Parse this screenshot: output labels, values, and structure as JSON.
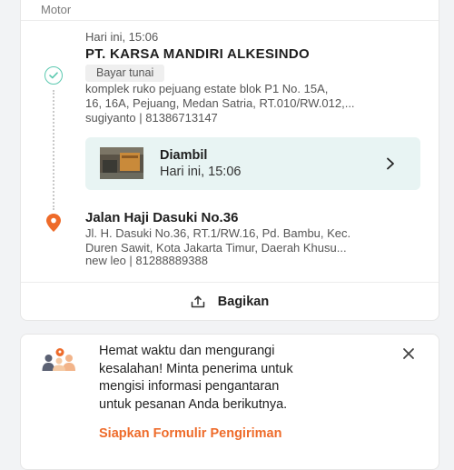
{
  "order": {
    "vehicle": "Motor",
    "sender": {
      "time": "Hari ini, 15:06",
      "name": "PT. KARSA MANDIRI ALKESINDO",
      "payment_badge": "Bayar tunai",
      "address_line1": "komplek ruko pejuang estate blok P1 No. 15A,",
      "address_line2": "16, 16A, Pejuang, Medan Satria, RT.010/RW.012,...",
      "contact": "sugiyanto | 81386713147"
    },
    "status": {
      "title": "Diambil",
      "time": "Hari ini, 15:06",
      "chevron_icon": "chevron-right-icon"
    },
    "recipient": {
      "street": "Jalan Haji Dasuki No.36",
      "address_line1": "Jl. H. Dasuki No.36, RT.1/RW.16, Pd. Bambu, Kec.",
      "address_line2": "Duren Sawit, Kota Jakarta Timur, Daerah Khusu...",
      "contact": "new leo | 81288889388"
    },
    "share": {
      "label": "Bagikan",
      "icon": "share-icon"
    }
  },
  "promo": {
    "text_line1": "Hemat waktu dan mengurangi",
    "text_line2": "kesalahan! Minta penerima untuk",
    "text_line3": "mengisi informasi pengantaran",
    "text_line4": "untuk pesanan Anda berikutnya.",
    "link": "Siapkan Formulir Pengiriman",
    "icon": "recipients-icon",
    "close_icon": "close-icon"
  },
  "colors": {
    "accent_orange": "#ee6b2a",
    "status_teal": "#5cc9b0",
    "status_bg": "#e8f4f3"
  }
}
